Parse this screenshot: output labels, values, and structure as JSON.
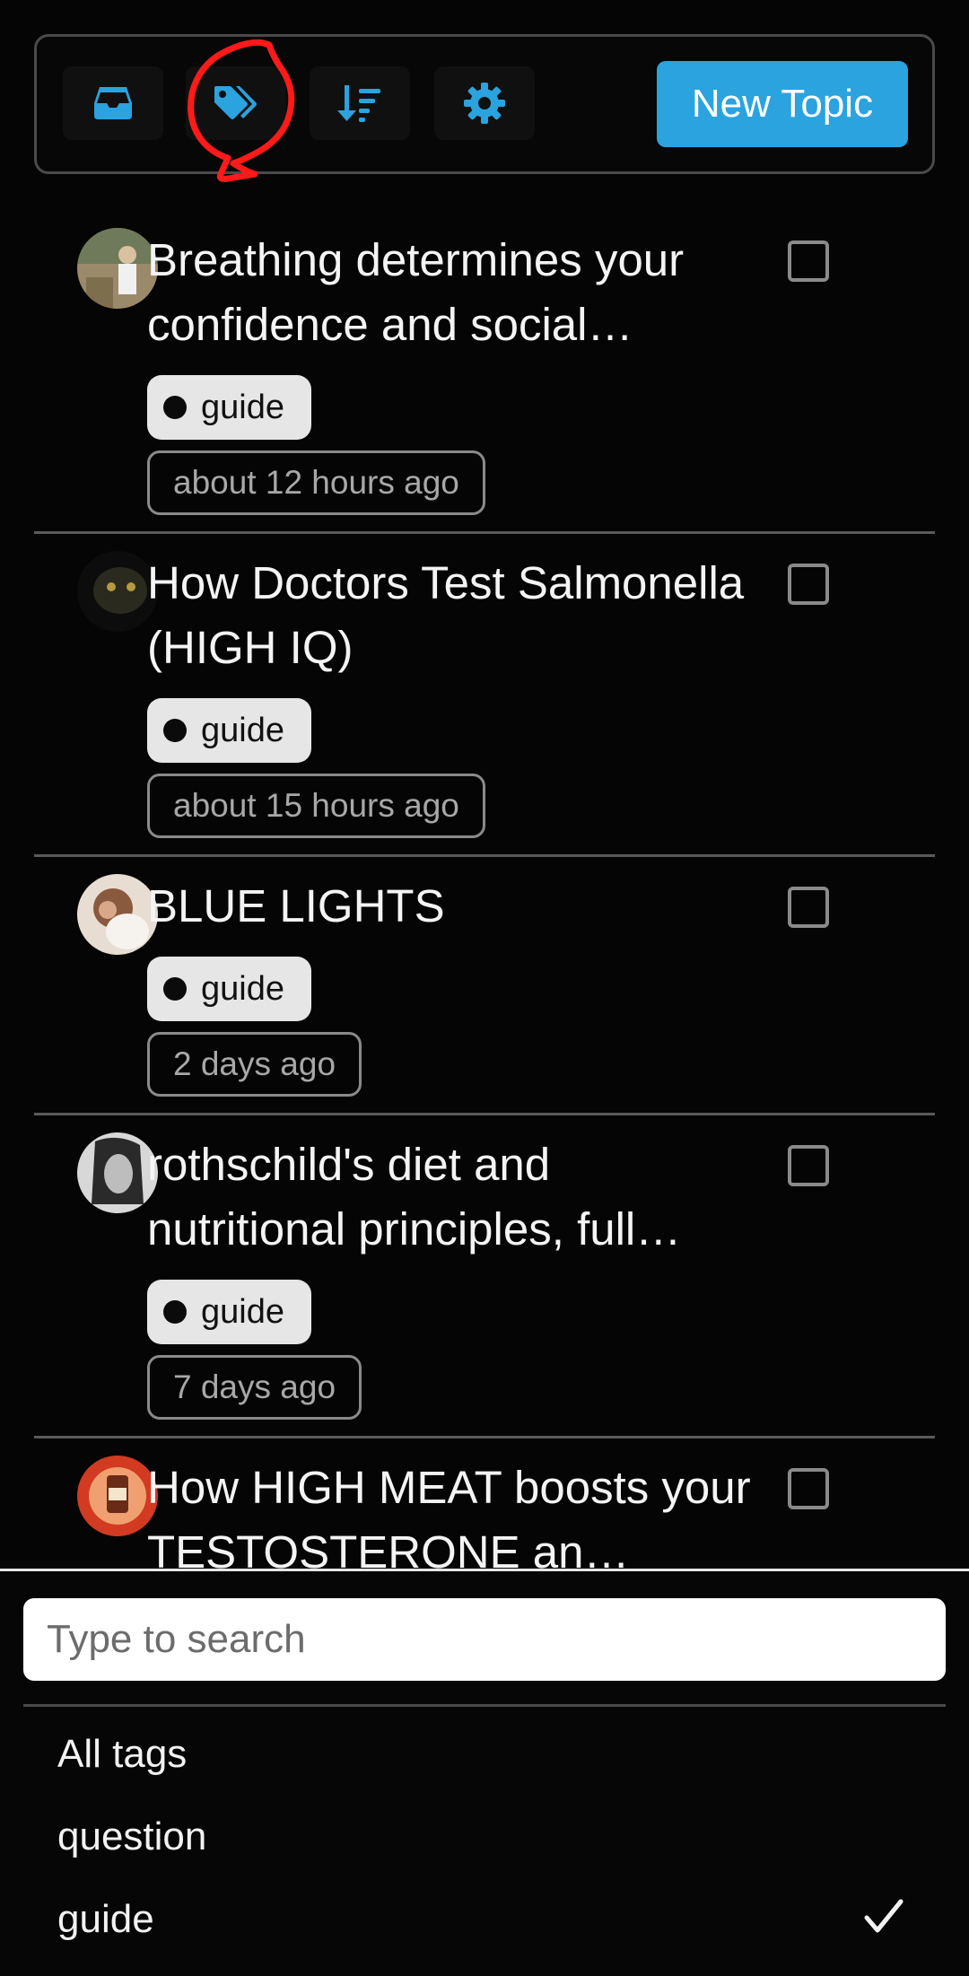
{
  "toolbar": {
    "icons": [
      "inbox-icon",
      "tags-icon",
      "sort-icon",
      "gear-icon"
    ],
    "new_topic_label": "New Topic",
    "accent_color": "#2aa3de",
    "annotation_color": "#ff0000"
  },
  "topics": [
    {
      "title": "Breathing determines your confidence and social…",
      "tag": "guide",
      "time": "about 12 hours ago"
    },
    {
      "title": "How Doctors Test Salmonella (HIGH IQ)",
      "tag": "guide",
      "time": "about 15 hours ago"
    },
    {
      "title": "BLUE LIGHTS",
      "tag": "guide",
      "time": "2 days ago"
    },
    {
      "title": "rothschild's diet and nutritional principles, full…",
      "tag": "guide",
      "time": "7 days ago"
    },
    {
      "title": "How HIGH MEAT boosts your TESTOSTERONE an…"
    }
  ],
  "tag_filter": {
    "search_placeholder": "Type to search",
    "options": [
      "All tags",
      "question",
      "guide"
    ],
    "selected": "guide"
  }
}
